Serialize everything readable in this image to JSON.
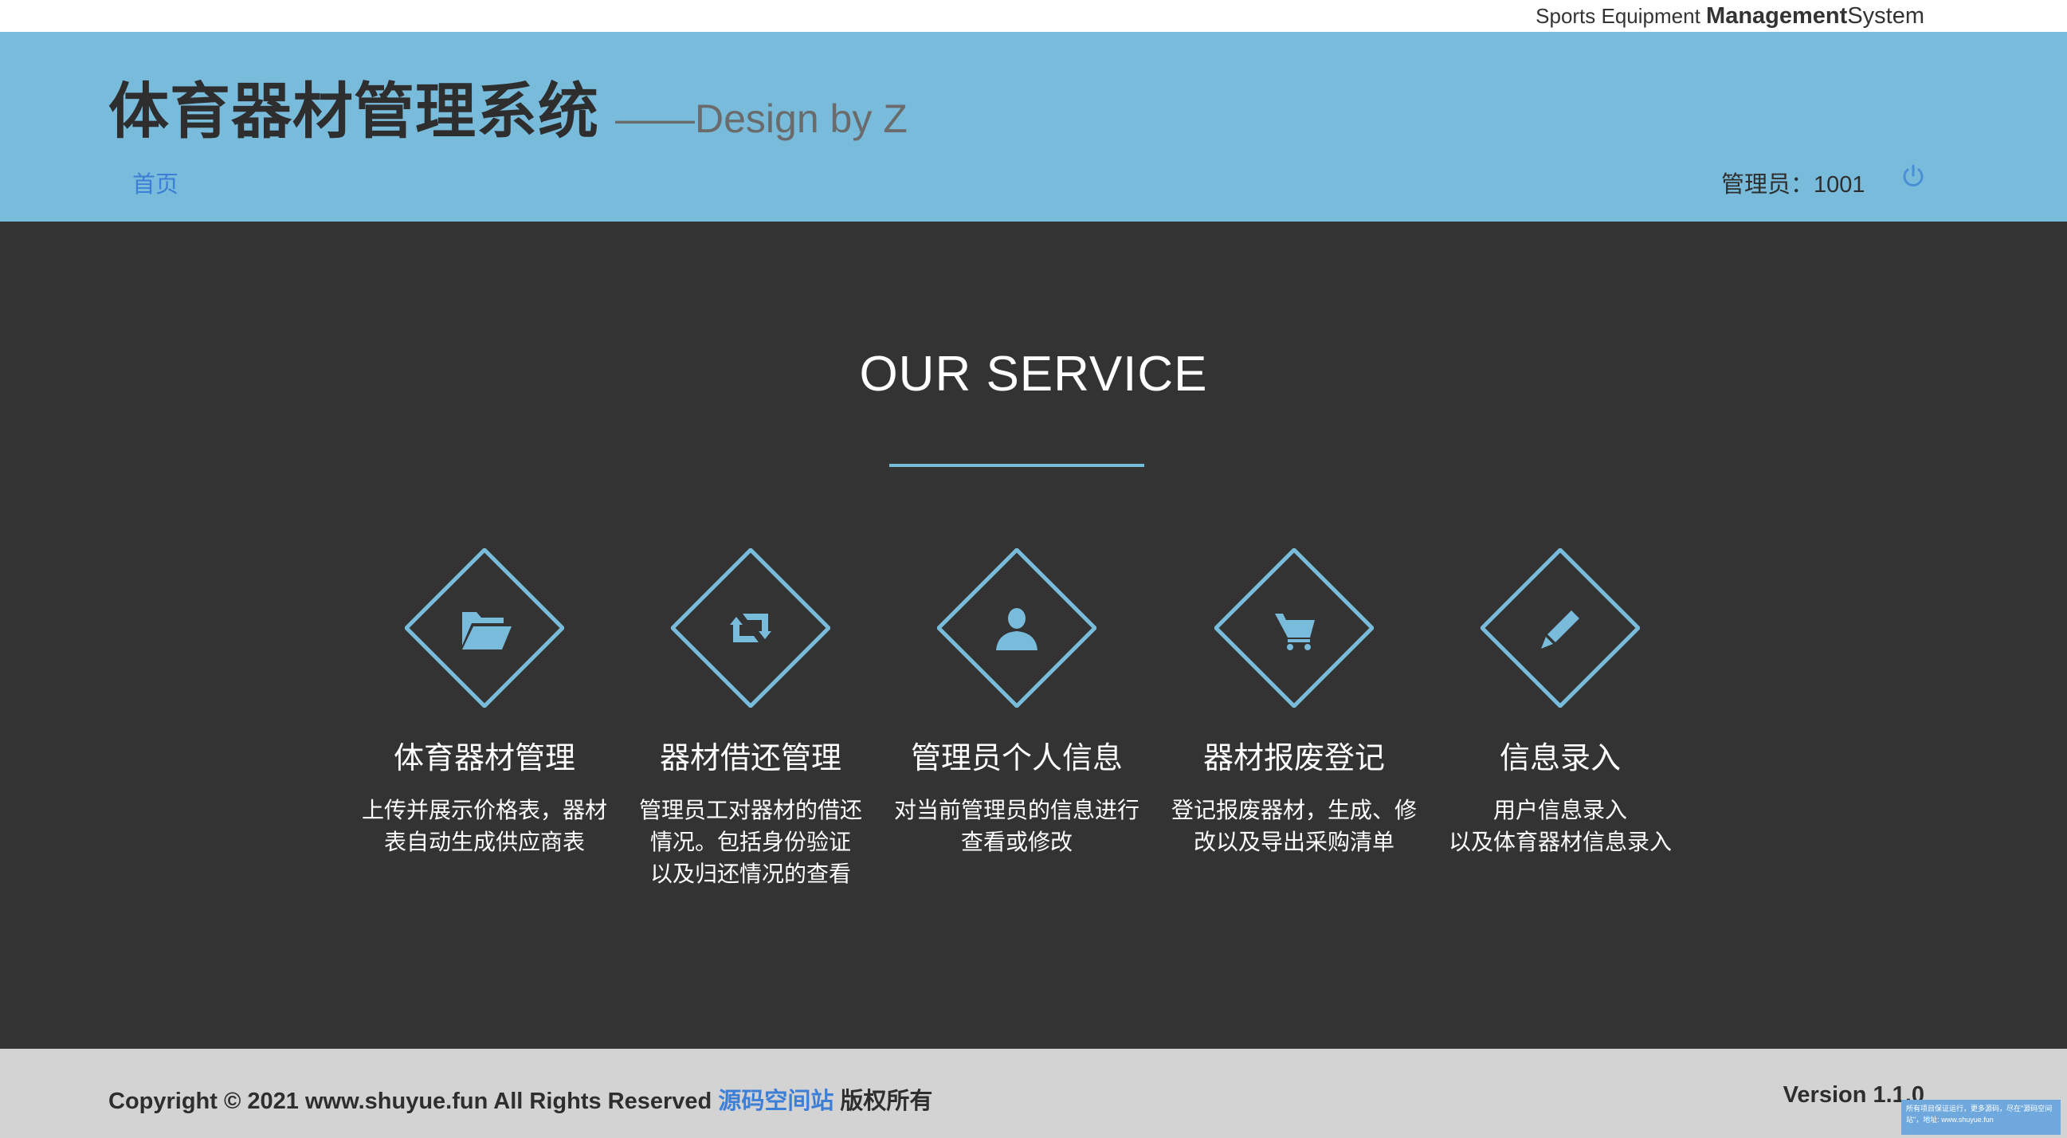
{
  "top_bar": {
    "small": "Sports Equipment",
    "bold": "Management",
    "tail": "System"
  },
  "header": {
    "title": "体育器材管理系统",
    "subtitle": "——Design by Z",
    "nav_home": "首页",
    "admin_label": "管理员：1001",
    "logout_icon": "power-icon"
  },
  "service": {
    "heading": "OUR SERVICE",
    "accent_color": "#78bbdb",
    "items": [
      {
        "icon": "folder-open-icon",
        "name": "体育器材管理",
        "desc": [
          "上传并展示价格表，器材",
          "表自动生成供应商表"
        ]
      },
      {
        "icon": "retweet-icon",
        "name": "器材借还管理",
        "desc": [
          "管理员工对器材的借还",
          "情况。包括身份验证",
          "以及归还情况的查看"
        ]
      },
      {
        "icon": "user-icon",
        "name": "管理员个人信息",
        "desc": [
          "对当前管理员的信息进行",
          "查看或修改"
        ]
      },
      {
        "icon": "shopping-cart-icon",
        "name": "器材报废登记",
        "desc": [
          "登记报废器材，生成、修",
          "改以及导出采购清单"
        ]
      },
      {
        "icon": "pencil-icon",
        "name": "信息录入",
        "desc": [
          "用户信息录入",
          "以及体育器材信息录入"
        ]
      }
    ]
  },
  "footer": {
    "copyright": "Copyright © 2021 www.shuyue.fun All Rights Reserved",
    "link": "源码空间站",
    "suffix": "版权所有",
    "version": "Version 1.1.0"
  },
  "corner_note": "所有项目保证运行，更多源码，尽在\"源码空间站\"，地址: www.shuyue.fun"
}
